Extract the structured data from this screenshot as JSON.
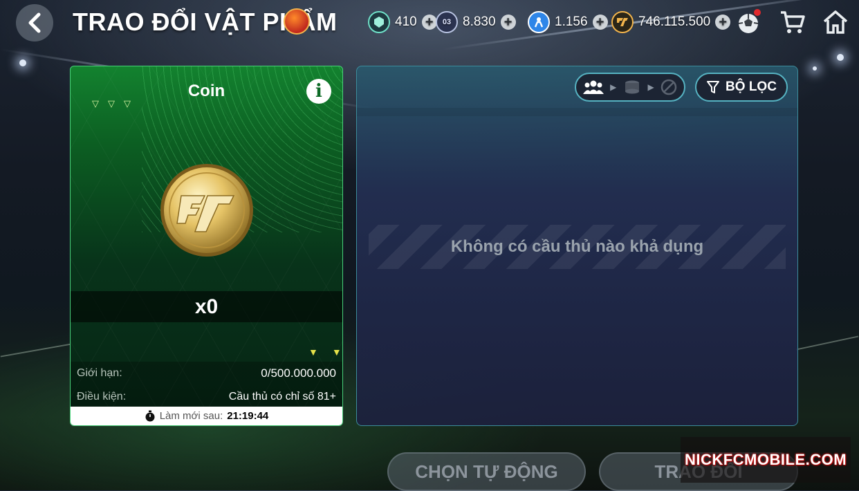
{
  "header": {
    "title": "TRAO ĐỔI VẬT PHẨM",
    "currencies": [
      {
        "icon": "gem-icon",
        "value": "410",
        "color": "#6fe0c8"
      },
      {
        "icon": "player-card-icon",
        "icon_text": "03",
        "value": "8.830",
        "color": "#b7c2e0"
      },
      {
        "icon": "trainer-icon",
        "value": "1.156",
        "color": "#2f86e8"
      },
      {
        "icon": "fc-coin-icon",
        "value": "746.115.500",
        "color": "#f2b44c"
      }
    ]
  },
  "card": {
    "title": "Coin",
    "quantity": "x0",
    "limit_label": "Giới hạn:",
    "limit_value": "0/500.000.000",
    "condition_label": "Điều kiện:",
    "condition_value": "Cầu thủ có chỉ số 81+",
    "refresh_label": "Làm mới sau:",
    "refresh_time": "21:19:44"
  },
  "panel": {
    "filter_label": "BỘ LỌC",
    "empty_message": "Không có cầu thủ nào khả dụng"
  },
  "actions": {
    "auto_select": "CHỌN TỰ ĐỘNG",
    "exchange": "TRAO ĐỔI"
  },
  "watermark": "NICKFCMOBILE.COM"
}
